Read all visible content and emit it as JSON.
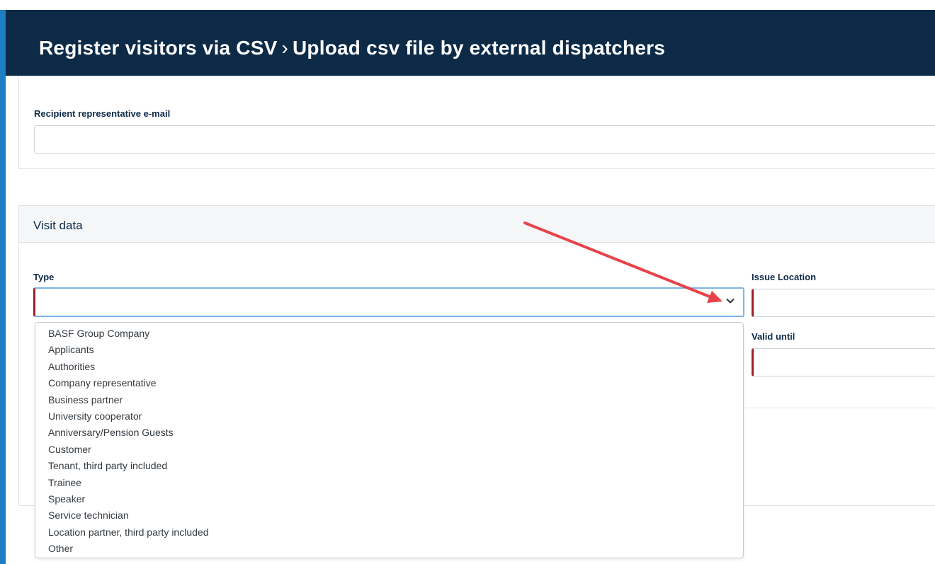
{
  "header": {
    "title_part1": "Register visitors via CSV",
    "separator": "›",
    "title_part2": "Upload csv file by external dispatchers"
  },
  "recipient": {
    "label": "Recipient representative e-mail",
    "value": ""
  },
  "visit": {
    "section_title": "Visit data",
    "type_label": "Type",
    "type_value": "",
    "issue_location_label": "Issue Location",
    "issue_location_value": "",
    "valid_until_label": "Valid until",
    "valid_until_value": "",
    "type_options": [
      "BASF Group Company",
      "Applicants",
      "Authorities",
      "Company representative",
      "Business partner",
      "University cooperator",
      "Anniversary/Pension Guests",
      "Customer",
      "Tenant, third party included",
      "Trainee",
      "Speaker",
      "Service technician",
      "Location partner, third party included",
      "Other"
    ]
  },
  "colors": {
    "header_bg": "#0d2a47",
    "accent_strip": "#1d7ec1",
    "required_marker": "#9b1f2a",
    "focus_border": "#7bb6e6",
    "annotation_arrow": "#e8424a"
  },
  "icons": {
    "select_chevron": "chevron-down-icon",
    "annotation": "red-arrow-annotation"
  }
}
